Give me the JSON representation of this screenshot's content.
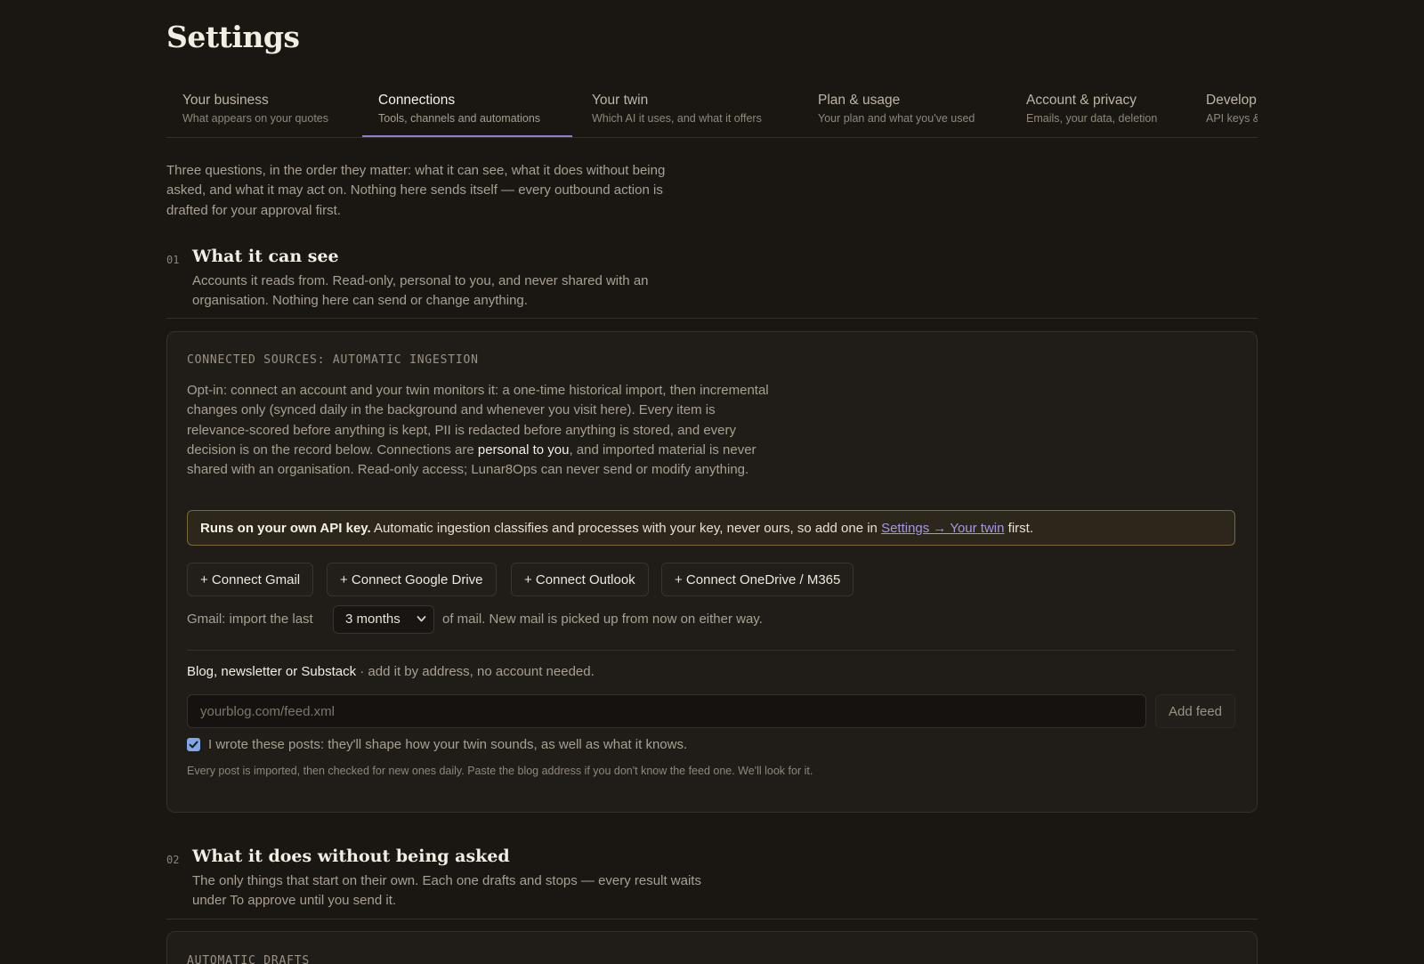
{
  "page_title": "Settings",
  "tabs": [
    {
      "label": "Your business",
      "sub": "What appears on your quotes"
    },
    {
      "label": "Connections",
      "sub": "Tools, channels and automations"
    },
    {
      "label": "Your twin",
      "sub": "Which AI it uses, and what it offers"
    },
    {
      "label": "Plan & usage",
      "sub": "Your plan and what you've used"
    },
    {
      "label": "Account & privacy",
      "sub": "Emails, your data, deletion"
    },
    {
      "label": "Develop",
      "sub": "API keys &"
    }
  ],
  "active_tab": "Connections",
  "intro": "Three questions, in the order they matter: what it can see, what it does without being asked, and what it may act on. Nothing here sends itself — every outbound action is drafted for your approval first.",
  "section1": {
    "num": "01",
    "title": "What it can see",
    "desc": "Accounts it reads from. Read-only, personal to you, and never shared with an organisation. Nothing here can send or change anything.",
    "card_label": "CONNECTED SOURCES: AUTOMATIC INGESTION",
    "card_desc_before": "Opt-in: connect an account and your twin monitors it: a one-time historical import, then incremental changes only (synced daily in the background and whenever you visit here). Every item is relevance-scored before anything is kept, PII is redacted before anything is stored, and every decision is on the record below. Connections are ",
    "card_desc_emph": "personal to you",
    "card_desc_after": ", and imported material is never shared with an organisation. Read-only access; Lunar8Ops can never send or modify anything.",
    "notice_strong": "Runs on your own API key.",
    "notice_text": " Automatic ingestion classifies and processes with your key, never ours, so add one in ",
    "notice_link": "Settings → Your twin",
    "notice_end": " first.",
    "connect_buttons": [
      "+ Connect Gmail",
      "+ Connect Google Drive",
      "+ Connect Outlook",
      "+ Connect OneDrive / M365"
    ],
    "gmail_prefix": "Gmail: import the last",
    "gmail_select_value": "3 months",
    "gmail_suffix": "of mail. New mail is picked up from now on either way.",
    "blog_label_strong": "Blog, newsletter or Substack",
    "blog_label_rest": " · add it by address, no account needed.",
    "feed_placeholder": "yourblog.com/feed.xml",
    "feed_value": "",
    "add_feed_label": "Add feed",
    "checkbox_checked": true,
    "checkbox_label": "I wrote these posts: they'll shape how your twin sounds, as well as what it knows.",
    "hint": "Every post is imported, then checked for new ones daily. Paste the blog address if you don't know the feed one. We'll look for it."
  },
  "section2": {
    "num": "02",
    "title": "What it does without being asked",
    "desc": "The only things that start on their own. Each one drafts and stops — every result waits under To approve until you send it.",
    "card_label": "AUTOMATIC DRAFTS"
  },
  "colors": {
    "background": "#1a1612",
    "accent": "#8f7fd6",
    "link": "#a597e6",
    "notice_border": "#7d6736",
    "checkbox": "#7fa7e6"
  }
}
